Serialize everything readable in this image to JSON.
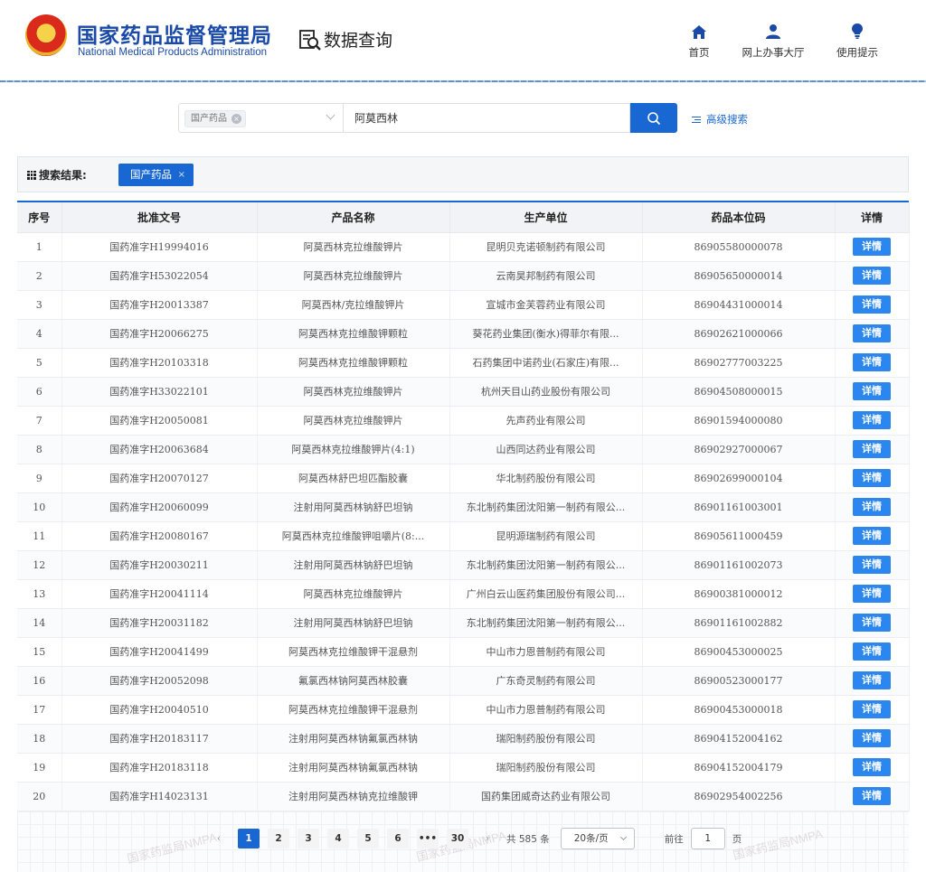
{
  "header": {
    "brand_cn": "国家药品监督管理局",
    "brand_en": "National Medical Products Administration",
    "query_title": "数据查询",
    "nav": [
      {
        "label": "首页",
        "icon": "home-icon"
      },
      {
        "label": "网上办事大厅",
        "icon": "user-icon"
      },
      {
        "label": "使用提示",
        "icon": "lightbulb-icon"
      }
    ]
  },
  "search": {
    "category_tag": "国产药品",
    "query_value": "阿莫西林",
    "advanced_label": "高级搜索"
  },
  "results": {
    "label": "搜索结果:",
    "filter_tag": "国产药品",
    "filter_close": "×"
  },
  "table": {
    "columns": [
      "序号",
      "批准文号",
      "产品名称",
      "生产单位",
      "药品本位码",
      "详情"
    ],
    "detail_label": "详情",
    "rows": [
      [
        "1",
        "国药准字H19994016",
        "阿莫西林克拉维酸钾片",
        "昆明贝克诺顿制药有限公司",
        "86905580000078"
      ],
      [
        "2",
        "国药准字H53022054",
        "阿莫西林克拉维酸钾片",
        "云南昊邦制药有限公司",
        "86905650000014"
      ],
      [
        "3",
        "国药准字H20013387",
        "阿莫西林/克拉维酸钾片",
        "宣城市金芙蓉药业有限公司",
        "86904431000014"
      ],
      [
        "4",
        "国药准字H20066275",
        "阿莫西林克拉维酸钾颗粒",
        "葵花药业集团(衡水)得菲尔有限...",
        "86902621000066"
      ],
      [
        "5",
        "国药准字H20103318",
        "阿莫西林克拉维酸钾颗粒",
        "石药集团中诺药业(石家庄)有限...",
        "86902777003225"
      ],
      [
        "6",
        "国药准字H33022101",
        "阿莫西林克拉维酸钾片",
        "杭州天目山药业股份有限公司",
        "86904508000015"
      ],
      [
        "7",
        "国药准字H20050081",
        "阿莫西林克拉维酸钾片",
        "先声药业有限公司",
        "86901594000080"
      ],
      [
        "8",
        "国药准字H20063684",
        "阿莫西林克拉维酸钾片(4:1)",
        "山西同达药业有限公司",
        "86902927000067"
      ],
      [
        "9",
        "国药准字H20070127",
        "阿莫西林舒巴坦匹酯胶囊",
        "华北制药股份有限公司",
        "86902699000104"
      ],
      [
        "10",
        "国药准字H20060099",
        "注射用阿莫西林钠舒巴坦钠",
        "东北制药集团沈阳第一制药有限公...",
        "86901161003001"
      ],
      [
        "11",
        "国药准字H20080167",
        "阿莫西林克拉维酸钾咀嚼片(8:...",
        "昆明源瑞制药有限公司",
        "86905611000459"
      ],
      [
        "12",
        "国药准字H20030211",
        "注射用阿莫西林钠舒巴坦钠",
        "东北制药集团沈阳第一制药有限公...",
        "86901161002073"
      ],
      [
        "13",
        "国药准字H20041114",
        "阿莫西林克拉维酸钾片",
        "广州白云山医药集团股份有限公司...",
        "86900381000012"
      ],
      [
        "14",
        "国药准字H20031182",
        "注射用阿莫西林钠舒巴坦钠",
        "东北制药集团沈阳第一制药有限公...",
        "86901161002882"
      ],
      [
        "15",
        "国药准字H20041499",
        "阿莫西林克拉维酸钾干混悬剂",
        "中山市力恩普制药有限公司",
        "86900453000025"
      ],
      [
        "16",
        "国药准字H20052098",
        "氟氯西林钠阿莫西林胶囊",
        "广东奇灵制药有限公司",
        "86900523000177"
      ],
      [
        "17",
        "国药准字H20040510",
        "阿莫西林克拉维酸钾干混悬剂",
        "中山市力恩普制药有限公司",
        "86900453000018"
      ],
      [
        "18",
        "国药准字H20183117",
        "注射用阿莫西林钠氟氯西林钠",
        "瑞阳制药股份有限公司",
        "86904152004162"
      ],
      [
        "19",
        "国药准字H20183118",
        "注射用阿莫西林钠氟氯西林钠",
        "瑞阳制药股份有限公司",
        "86904152004179"
      ],
      [
        "20",
        "国药准字H14023131",
        "注射用阿莫西林钠克拉维酸钾",
        "国药集团威奇达药业有限公司",
        "86902954002256"
      ]
    ]
  },
  "pagination": {
    "prev": "‹",
    "pages": [
      "1",
      "2",
      "3",
      "4",
      "5",
      "6",
      "•••",
      "30"
    ],
    "active": "1",
    "next": "›",
    "total": "共 585 条",
    "page_size": "20条/页",
    "goto_prefix": "前往",
    "goto_value": "1",
    "goto_suffix": "页"
  },
  "watermark": "国家药监局NMPA",
  "colors": {
    "brand_blue": "#1a4aa8",
    "accent": "#1967d2",
    "detail_button": "#2b86f0"
  }
}
